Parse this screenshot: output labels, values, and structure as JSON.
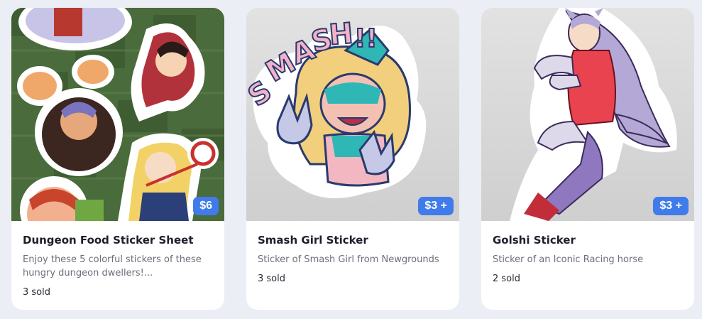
{
  "products": [
    {
      "title": "Dungeon Food Sticker Sheet",
      "description": "Enjoy these 5 colorful stickers of these hungry dungeon dwellers!...",
      "sold": "3 sold",
      "price": "$6",
      "image_icon": "sticker-sheet-image"
    },
    {
      "title": "Smash Girl Sticker",
      "description": "Sticker of Smash Girl from Newgrounds",
      "sold": "3 sold",
      "price": "$3 +",
      "image_icon": "smash-girl-image",
      "sticker_text": "SMASH!!"
    },
    {
      "title": "Golshi Sticker",
      "description": "Sticker of an Iconic Racing horse",
      "sold": "2 sold",
      "price": "$3 +",
      "image_icon": "golshi-image"
    }
  ],
  "colors": {
    "accent": "#3f7bea",
    "page_bg": "#eceef5",
    "card_bg": "#ffffff"
  }
}
